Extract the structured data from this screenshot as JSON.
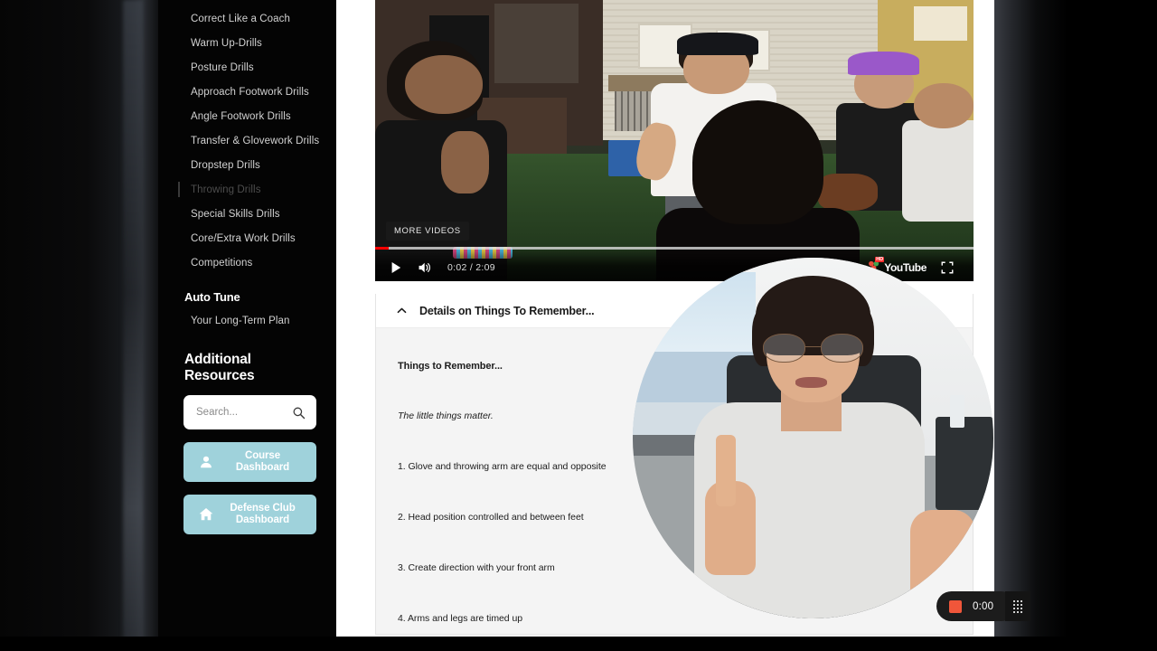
{
  "sidebar": {
    "nav_items": [
      {
        "label": "",
        "state": "clipped"
      },
      {
        "label": "Correct Like a Coach",
        "state": "normal"
      },
      {
        "label": "Warm Up-Drills",
        "state": "normal"
      },
      {
        "label": "Posture Drills",
        "state": "normal"
      },
      {
        "label": "Approach Footwork Drills",
        "state": "normal"
      },
      {
        "label": "Angle Footwork Drills",
        "state": "normal"
      },
      {
        "label": "Transfer & Glovework Drills",
        "state": "normal"
      },
      {
        "label": "Dropstep Drills",
        "state": "normal"
      },
      {
        "label": "Throwing Drills",
        "state": "active"
      },
      {
        "label": "Special Skills Drills",
        "state": "normal"
      },
      {
        "label": "Core/Extra Work Drills",
        "state": "normal"
      },
      {
        "label": "Competitions",
        "state": "normal"
      }
    ],
    "auto_tune_heading": "Auto Tune",
    "auto_tune_item": "Your Long-Term Plan",
    "resources_heading": "Additional Resources",
    "search": {
      "placeholder": "Search...",
      "value": "",
      "icon": "search-icon"
    },
    "buttons": [
      {
        "label": "Course\nDashboard",
        "icon": "person-icon",
        "color": "#9fd2db"
      },
      {
        "label": "Defense Club\nDashboard",
        "icon": "home-icon",
        "color": "#9fd2db"
      }
    ]
  },
  "player": {
    "more_videos_label": "MORE VIDEOS",
    "current_time": "0:02",
    "duration": "2:09",
    "time_display": "0:02 / 2:09",
    "progress_percent": 2,
    "play_icon": "play-icon",
    "volume_icon": "volume-icon",
    "hd_badge": "HD",
    "youtube_label": "YouTube",
    "fullscreen_icon": "fullscreen-icon",
    "progress_color": "#ff0000"
  },
  "card": {
    "chevron_icon": "chevron-up-icon",
    "title": "Details on Things To Remember...",
    "body_heading": "Things to Remember...",
    "body_subtitle": "The little things matter.",
    "items": [
      "1. Glove and throwing arm are equal and opposite",
      "2. Head position controlled and between feet",
      "3. Create direction with your front arm",
      "4. Arms and legs are timed up"
    ]
  },
  "recorder": {
    "timer": "0:00",
    "stop_icon": "stop-square-icon",
    "stop_color": "#f0563a",
    "drag_handle_icon": "drag-handle-icon"
  }
}
